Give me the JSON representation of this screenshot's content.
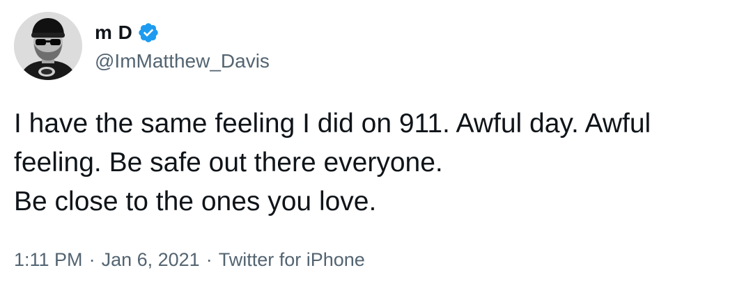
{
  "user": {
    "display_name": "m D",
    "handle": "@ImMatthew_Davis",
    "verified": true,
    "verified_icon": "verified-badge-icon",
    "verified_color": "#1d9bf0"
  },
  "tweet": {
    "text": "I have the same feeling I did on 911. Awful day. Awful feeling. Be safe out there everyone.\nBe close to the ones you love."
  },
  "meta": {
    "time": "1:11 PM",
    "separator": "·",
    "date": "Jan 6, 2021",
    "source": "Twitter for iPhone"
  },
  "colors": {
    "text": "#0f1419",
    "secondary": "#536471"
  }
}
